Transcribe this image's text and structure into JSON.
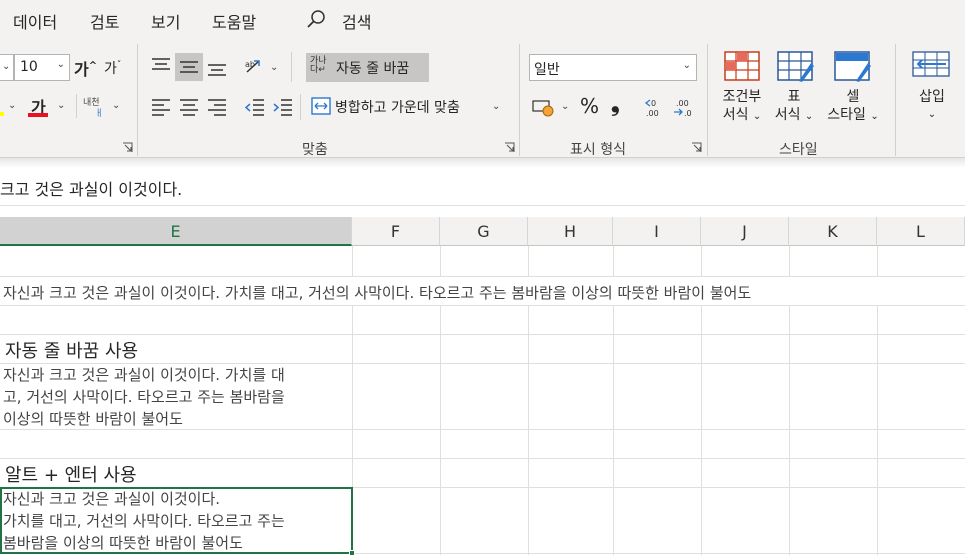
{
  "menu": {
    "items": [
      "데이터",
      "검토",
      "보기",
      "도움말"
    ],
    "search_label": "검색"
  },
  "font": {
    "size": "10",
    "grow_glyph": "가",
    "shrink_glyph": "가",
    "color_glyph": "가",
    "phonetic_glyph": "내천"
  },
  "alignment": {
    "wrap_text_icon": "가나\n다",
    "wrap_text_label": "자동 줄 바꿈",
    "merge_label": "병합하고 가운데 맞춤",
    "group_label": "맞춤"
  },
  "number": {
    "format_value": "일반",
    "percent": "%",
    "comma": "9",
    "group_label": "표시 형식"
  },
  "styles": {
    "conditional_line1": "조건부",
    "conditional_line2": "서식",
    "table_line1": "표",
    "table_line2": "서식",
    "cell_line1": "셀",
    "cell_line2": "스타일",
    "group_label": "스타일"
  },
  "cells": {
    "insert_label": "삽입"
  },
  "formula_bar": {
    "content": "크고 것은 과실이 이것이다."
  },
  "columns": [
    "E",
    "F",
    "G",
    "H",
    "I",
    "J",
    "K",
    "L"
  ],
  "selected_column": "E",
  "sheet": {
    "overflow_text": "자신과 크고 것은 과실이 이것이다. 가치를 대고, 거선의 사막이다. 타오르고 주는 봄바람을 이상의 따뜻한 바람이 불어도",
    "heading_wrap": "자동 줄 바꿈 사용",
    "wrap_lines": [
      "자신과 크고 것은 과실이 이것이다. 가치를 대",
      "고, 거선의 사막이다. 타오르고 주는 봄바람을",
      "이상의 따뜻한 바람이 불어도"
    ],
    "heading_alt": "알트 + 엔터 사용",
    "alt_lines": [
      "자신과 크고 것은 과실이 이것이다.",
      "가치를 대고, 거선의 사막이다. 타오르고 주는",
      "봄바람을 이상의 따뜻한 바람이 불어도"
    ]
  },
  "colors": {
    "accent": "#217346",
    "ribbon_bg": "#f3f2f1",
    "font_color_bar": "#e81123"
  }
}
